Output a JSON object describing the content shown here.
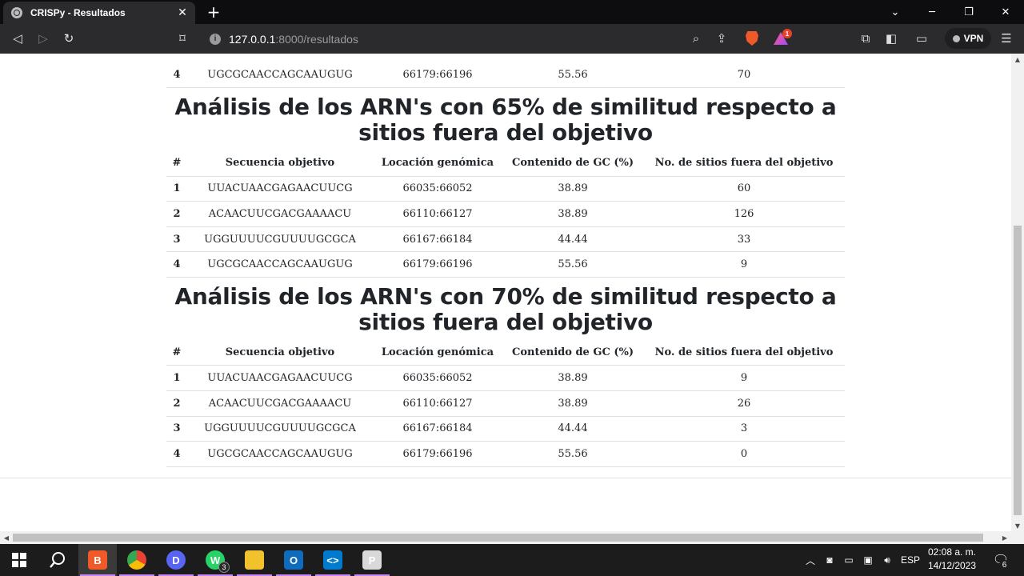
{
  "browser": {
    "tab_title": "CRISPy - Resultados",
    "url_host": "127.0.0.1",
    "url_path": ":8000/resultados",
    "vpn_label": "VPN",
    "rewards_badge": "1"
  },
  "page": {
    "top_partial_row": {
      "num": "4",
      "sequence": "UGCGCAACCAGCAAUGUG",
      "location": "66179:66196",
      "gc": "55.56",
      "offtargets": "70"
    },
    "columns": [
      "#",
      "Secuencia objetivo",
      "Locación genómica",
      "Contenido de GC (%)",
      "No. de sitios fuera del objetivo"
    ],
    "sections": [
      {
        "title": "Análisis de los ARN's con 65% de similitud respecto a sitios fuera del objetivo",
        "rows": [
          {
            "num": "1",
            "sequence": "UUACUAACGAGAACUUCG",
            "location": "66035:66052",
            "gc": "38.89",
            "offtargets": "60"
          },
          {
            "num": "2",
            "sequence": "ACAACUUCGACGAAAACU",
            "location": "66110:66127",
            "gc": "38.89",
            "offtargets": "126"
          },
          {
            "num": "3",
            "sequence": "UGGUUUUCGUUUUGCGCA",
            "location": "66167:66184",
            "gc": "44.44",
            "offtargets": "33"
          },
          {
            "num": "4",
            "sequence": "UGCGCAACCAGCAAUGUG",
            "location": "66179:66196",
            "gc": "55.56",
            "offtargets": "9"
          }
        ]
      },
      {
        "title": "Análisis de los ARN's con 70% de similitud respecto a sitios fuera del objetivo",
        "rows": [
          {
            "num": "1",
            "sequence": "UUACUAACGAGAACUUCG",
            "location": "66035:66052",
            "gc": "38.89",
            "offtargets": "9"
          },
          {
            "num": "2",
            "sequence": "ACAACUUCGACGAAAACU",
            "location": "66110:66127",
            "gc": "38.89",
            "offtargets": "26"
          },
          {
            "num": "3",
            "sequence": "UGGUUUUCGUUUUGCGCA",
            "location": "66167:66184",
            "gc": "44.44",
            "offtargets": "3"
          },
          {
            "num": "4",
            "sequence": "UGCGCAACCAGCAAUGUG",
            "location": "66179:66196",
            "gc": "55.56",
            "offtargets": "0"
          }
        ]
      }
    ]
  },
  "taskbar": {
    "apps": [
      {
        "name": "brave",
        "color": "#f05a28",
        "glyph": "B",
        "active": true
      },
      {
        "name": "chrome",
        "color": "#2f9e44",
        "glyph": "",
        "active": false
      },
      {
        "name": "discord",
        "color": "#5865f2",
        "glyph": "D",
        "active": false
      },
      {
        "name": "whatsapp",
        "color": "#25d366",
        "glyph": "W",
        "active": false,
        "count": "3"
      },
      {
        "name": "file-explorer",
        "color": "#f2c12e",
        "glyph": "",
        "active": false
      },
      {
        "name": "outlook",
        "color": "#0f6cbd",
        "glyph": "O",
        "active": false
      },
      {
        "name": "vscode",
        "color": "#007acc",
        "glyph": "<>",
        "active": false
      },
      {
        "name": "paint",
        "color": "#d9d9d9",
        "glyph": "P",
        "active": false
      }
    ],
    "language": "ESP",
    "time": "02:08 a. m.",
    "date": "14/12/2023",
    "notification_count": "6"
  }
}
